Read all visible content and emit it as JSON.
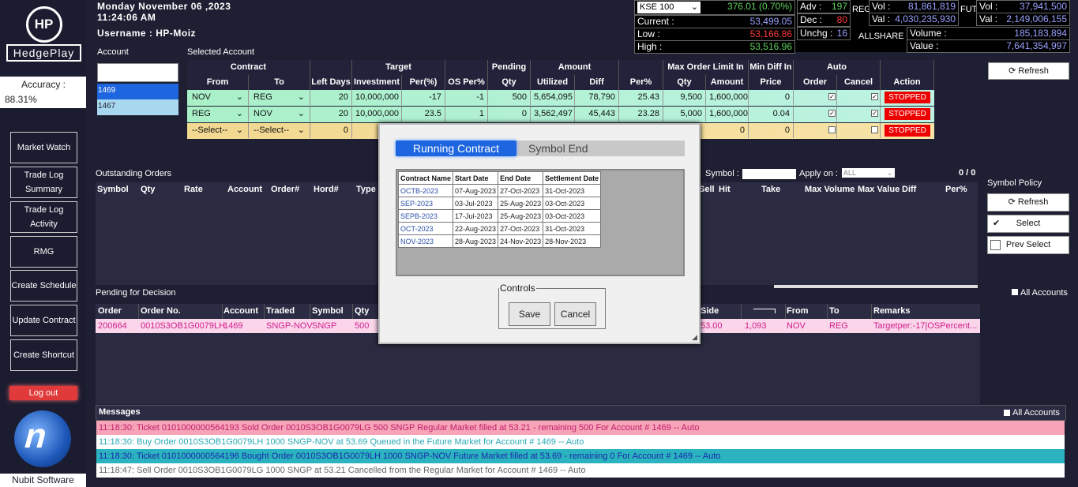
{
  "sidebar": {
    "logo_mark": "HP",
    "logo_name": "HedgePlay",
    "accuracy_label": "Accuracy :",
    "accuracy_value": "88.31%",
    "nav": [
      "Market Watch",
      "Trade Log Summary",
      "Trade Log Activity",
      "RMG",
      "Create Schedule",
      "Update Contract",
      "Create Shortcut"
    ],
    "logout": "Log out",
    "company": "Nubit Software"
  },
  "header": {
    "date": "Monday November 06 ,2023",
    "time": "11:24:06 AM",
    "username": "Username : HP-Moiz",
    "account_label": "Account",
    "selected_account_label": "Selected Account",
    "accounts": [
      "1469",
      "1467"
    ]
  },
  "market": {
    "index": "KSE 100",
    "index_value": "376.01 (0.70%)",
    "current_label": "Current :",
    "current": "53,499.05",
    "low_label": "Low :",
    "low": "53,166.86",
    "high_label": "High :",
    "high": "53,516.96",
    "adv_label": "Adv :",
    "adv": "197",
    "dec_label": "Dec :",
    "dec": "80",
    "unchg_label": "Unchg :",
    "unchg": "16",
    "reg": "REG",
    "reg_vol_label": "Vol :",
    "reg_vol": "81,861,819",
    "reg_val_label": "Val :",
    "reg_val": "4,030,235,930",
    "fut": "FUT",
    "fut_vol_label": "Vol :",
    "fut_vol": "37,941,500",
    "fut_val_label": "Val :",
    "fut_val": "2,149,006,155",
    "allshare": "ALLSHARE",
    "volume_label": "Volume :",
    "volume": "185,183,894",
    "value_label": "Value :",
    "value": "7,641,354,997"
  },
  "contract_table": {
    "group_headers": [
      "Contract",
      "Target",
      "Pending",
      "Amount",
      "Max Order Limit In",
      "Min Diff In",
      "Auto"
    ],
    "headers": [
      "From",
      "To",
      "Left Days",
      "Investment",
      "Per(%)",
      "OS Per%",
      "Qty",
      "Utilized",
      "Diff",
      "Per%",
      "Qty",
      "Amount",
      "Price",
      "Order",
      "Cancel",
      "Action"
    ],
    "rows": [
      {
        "from": "NOV",
        "to": "REG",
        "left_days": "20",
        "investment": "10,000,000",
        "per": "-17",
        "os_per": "-1",
        "qty": "500",
        "utilized": "5,654,095",
        "diff": "78,790",
        "per2": "25.43",
        "max_qty": "9,500",
        "max_amount": "1,600,000",
        "min_price": "0",
        "order": true,
        "cancel": true,
        "action": "STOPPED"
      },
      {
        "from": "REG",
        "to": "NOV",
        "left_days": "20",
        "investment": "10,000,000",
        "per": "23.5",
        "os_per": "1",
        "qty": "0",
        "utilized": "3,562,497",
        "diff": "45,443",
        "per2": "23.28",
        "max_qty": "5,000",
        "max_amount": "1,600,000",
        "min_price": "0.04",
        "order": true,
        "cancel": true,
        "action": "STOPPED"
      },
      {
        "from": "--Select--",
        "to": "--Select--",
        "left_days": "0",
        "max_amount": "0",
        "min_price": "0",
        "order": false,
        "cancel": false,
        "action": "STOPPED"
      }
    ]
  },
  "refresh_label": "Refresh",
  "outstanding": {
    "title": "Outstanding Orders",
    "headers_left": [
      "Symbol",
      "Qty",
      "Rate",
      "Account",
      "Order#",
      "Hord#",
      "Type"
    ],
    "headers_right": [
      "Sell",
      "Hit",
      "Take",
      "Max Volume",
      "Max Value",
      "Diff",
      "Per%"
    ],
    "symbol_label": "Symbol :",
    "apply_label": "Apply on :",
    "apply_value": "ALL",
    "count": "0 / 0"
  },
  "symbol_policy": {
    "title": "Symbol Policy",
    "refresh": "Refresh",
    "select": "Select",
    "prev_select": "Prev Select"
  },
  "pending": {
    "title": "Pending for Decision",
    "all_accounts": "All Accounts",
    "headers_left": [
      "Order",
      "Order No.",
      "Account",
      "Traded",
      "Symbol",
      "Qty"
    ],
    "headers_right": [
      "Side",
      "",
      "From",
      "To",
      "Remarks"
    ],
    "row": {
      "order": "200664",
      "order_no": "0010S3OB1G0079LH",
      "account": "1469",
      "traded": "SNGP-NOV",
      "symbol": "SNGP",
      "qty": "500",
      "side": "53.00",
      "hit": "1,093",
      "from": "NOV",
      "to": "REG",
      "remarks": "Targetper:-17|OSPercent..."
    }
  },
  "modal": {
    "tab_running": "Running Contract",
    "tab_symbol_end": "Symbol End",
    "headers": [
      "Contract Name",
      "Start Date",
      "End Date",
      "Settlement Date"
    ],
    "rows": [
      [
        "OCTB-2023",
        "07-Aug-2023",
        "27-Oct-2023",
        "31-Oct-2023"
      ],
      [
        "SEP-2023",
        "03-Jul-2023",
        "25-Aug-2023",
        "03-Oct-2023"
      ],
      [
        "SEPB-2023",
        "17-Jul-2023",
        "25-Aug-2023",
        "03-Oct-2023"
      ],
      [
        "OCT-2023",
        "22-Aug-2023",
        "27-Oct-2023",
        "31-Oct-2023"
      ],
      [
        "NOV-2023",
        "28-Aug-2023",
        "24-Nov-2023",
        "28-Nov-2023"
      ]
    ],
    "controls_label": "Controls",
    "save": "Save",
    "cancel": "Cancel"
  },
  "messages": {
    "title": "Messages",
    "all_accounts": "All Accounts",
    "items": [
      {
        "text": "11:18:30: Ticket 0101000000564193 Sold Order 0010S3OB1G0079LG 500 SNGP Regular Market filled at 53.21 - remaining 500 For Account # 1469 -- Auto",
        "bg": "#f7a3b8",
        "color": "#c0206a"
      },
      {
        "text": "11:18:30: Buy Order 0010S3OB1G0079LH 1000 SNGP-NOV at 53.69 Queued in the Future Market for Account # 1469 -- Auto",
        "bg": "#ffffff",
        "color": "#2aa9b5"
      },
      {
        "text": "11:18:30: Ticket 0101000000564196 Bought Order 0010S3OB1G0079LH 1000 SNGP-NOV Future Market filled at 53.69 - remaining 0 For Account # 1469 -- Auto",
        "bg": "#2bb3c0",
        "color": "#1a2aa8"
      },
      {
        "text": "11:18:47: Sell Order 0010S3OB1G0079LG 1000 SNGP at 53.21 Cancelled from the Regular Market for Account # 1469 -- Auto",
        "bg": "#ffffff",
        "color": "#666666"
      }
    ]
  }
}
